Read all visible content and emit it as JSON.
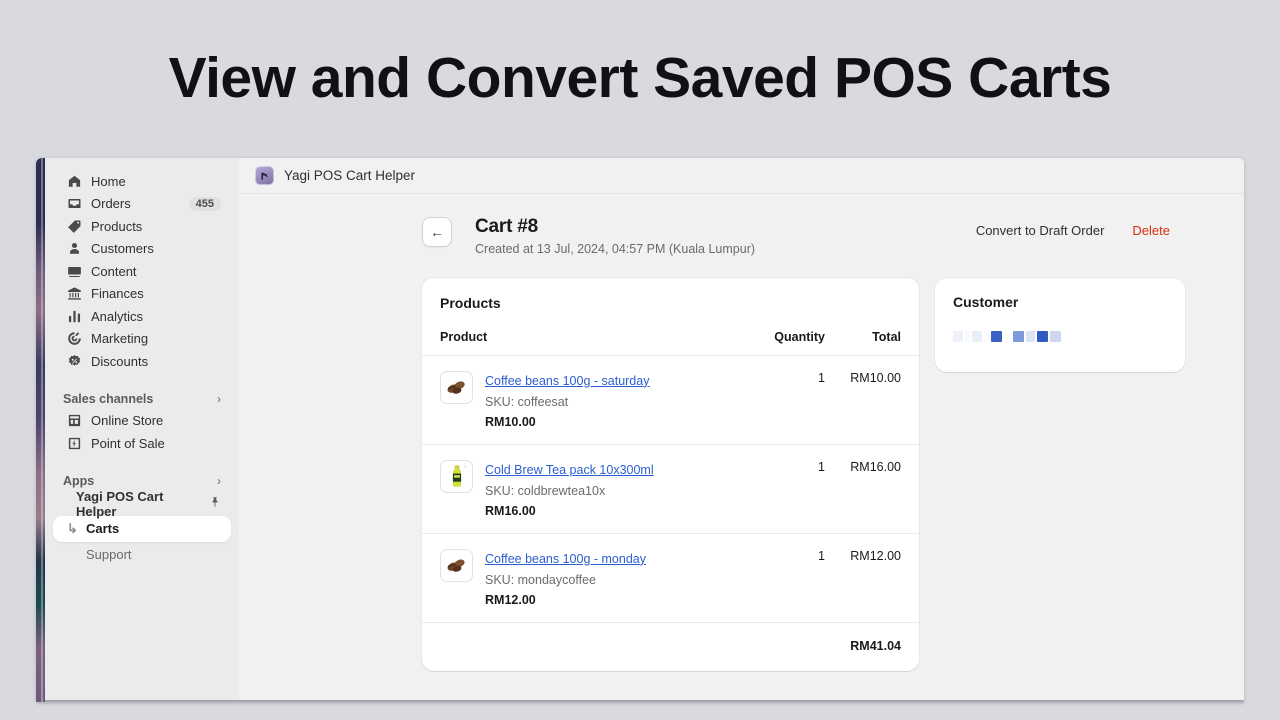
{
  "banner": {
    "title": "View and Convert Saved POS Carts"
  },
  "appbar": {
    "icon": "app-logo-icon",
    "title": "Yagi POS Cart Helper"
  },
  "sidebar": {
    "items": [
      {
        "label": "Home",
        "icon": "home-icon",
        "badge": ""
      },
      {
        "label": "Orders",
        "icon": "orders-inbox-icon",
        "badge": "455"
      },
      {
        "label": "Products",
        "icon": "product-tag-icon",
        "badge": ""
      },
      {
        "label": "Customers",
        "icon": "person-icon",
        "badge": ""
      },
      {
        "label": "Content",
        "icon": "content-media-icon",
        "badge": ""
      },
      {
        "label": "Finances",
        "icon": "bank-icon",
        "badge": ""
      },
      {
        "label": "Analytics",
        "icon": "bar-chart-icon",
        "badge": ""
      },
      {
        "label": "Marketing",
        "icon": "target-icon",
        "badge": ""
      },
      {
        "label": "Discounts",
        "icon": "discount-badge-icon",
        "badge": ""
      }
    ],
    "sales_channels": {
      "heading": "Sales channels",
      "chevron": "›",
      "items": [
        {
          "label": "Online Store",
          "icon": "storefront-icon"
        },
        {
          "label": "Point of Sale",
          "icon": "pos-terminal-icon"
        }
      ]
    },
    "apps": {
      "heading": "Apps",
      "chevron": "›",
      "app_name": "Yagi POS Cart Helper",
      "app_icon": "yagi-app-icon",
      "pin_icon": "pin-icon",
      "sub_items": [
        {
          "label": "Carts",
          "selected": true,
          "branch_icon": "branch-arrow-icon"
        },
        {
          "label": "Support",
          "selected": false
        }
      ]
    }
  },
  "page": {
    "back_icon": "back-arrow-icon",
    "title": "Cart #8",
    "subtitle": "Created at 13 Jul, 2024, 04:57 PM (Kuala Lumpur)",
    "actions": {
      "convert_label": "Convert to Draft Order",
      "delete_label": "Delete",
      "delete_color": "#d72c0d"
    }
  },
  "products_card": {
    "title": "Products",
    "columns": {
      "product": "Product",
      "quantity": "Quantity",
      "total": "Total"
    },
    "rows": [
      {
        "name": "Coffee beans 100g - saturday",
        "sku": "SKU: coffeesat",
        "price": "RM10.00",
        "quantity": "1",
        "total": "RM10.00",
        "thumb": "coffee-beans-image"
      },
      {
        "name": "Cold Brew Tea pack 10x300ml",
        "sku": "SKU: coldbrewtea10x",
        "price": "RM16.00",
        "quantity": "1",
        "total": "RM16.00",
        "thumb": "cold-brew-bottle-image"
      },
      {
        "name": "Coffee beans 100g - monday",
        "sku": "SKU: mondaycoffee",
        "price": "RM12.00",
        "quantity": "1",
        "total": "RM12.00",
        "thumb": "coffee-beans-image"
      }
    ],
    "grand_total": "RM41.04"
  },
  "customer_card": {
    "title": "Customer",
    "redacted_name": true
  },
  "colors": {
    "link": "#2c5ecf",
    "danger": "#d72c0d",
    "sidebar_bg": "#ebebeb",
    "content_bg": "#f1f1f1",
    "page_bg": "#d9d9e0"
  }
}
